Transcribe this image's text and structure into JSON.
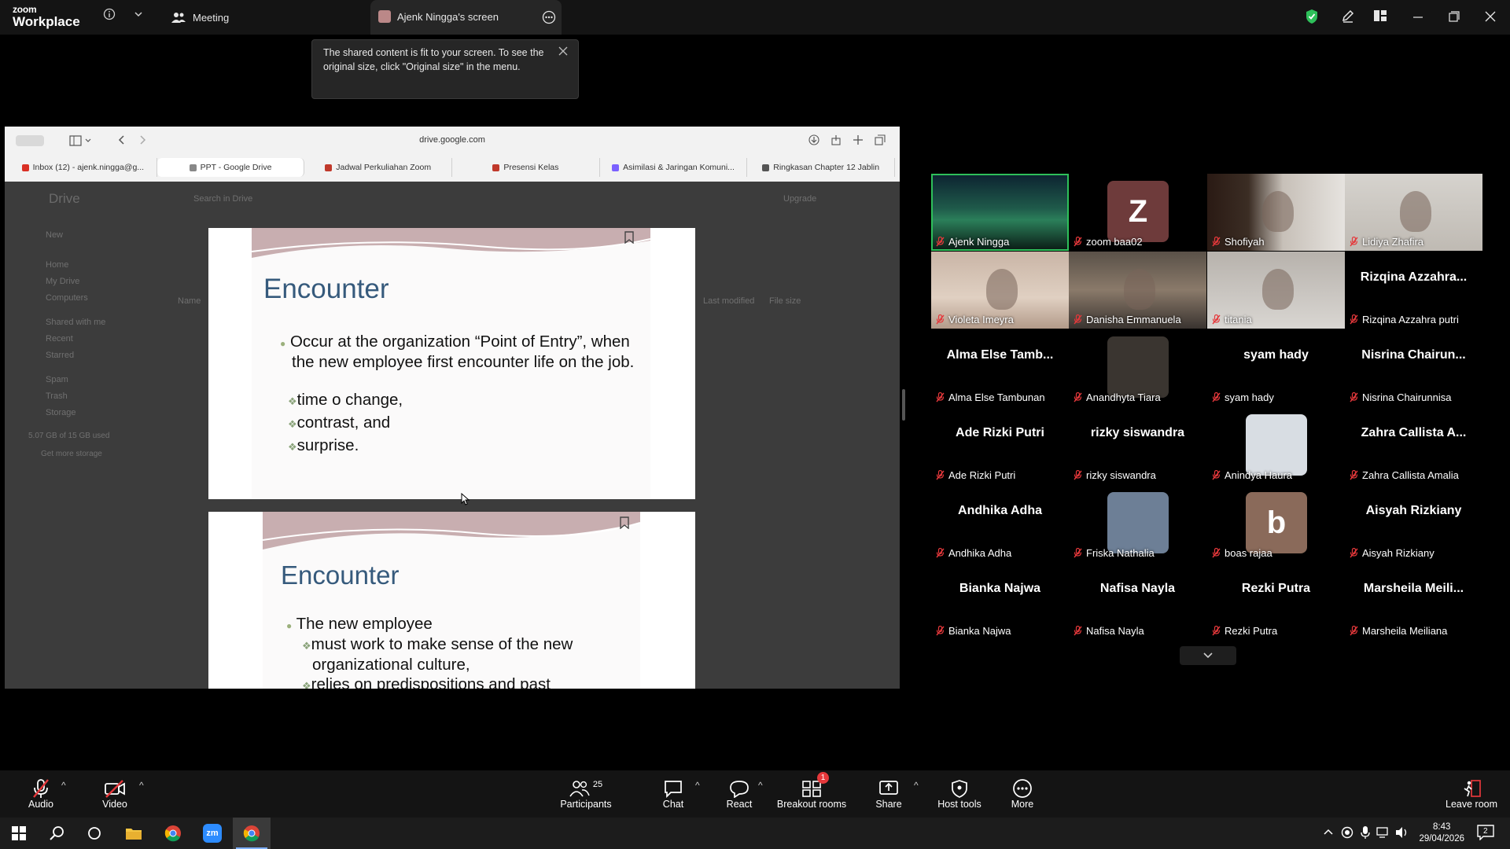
{
  "app": {
    "logo_line1": "zoom",
    "logo_line2": "Workplace"
  },
  "topbar": {
    "meeting_tab": "Meeting",
    "screen_tab": "Ajenk Ningga's screen",
    "icons": [
      "info-icon",
      "chevron-down-icon",
      "people-icon",
      "more-icon",
      "shield-check-icon",
      "pen-icon",
      "layout-icon",
      "minimize-icon",
      "maximize-icon",
      "close-icon"
    ],
    "security_color": "#2ec05a"
  },
  "tooltip": {
    "text": "The shared content is fit to your screen. To see the original size, click \"Original size\" in the menu."
  },
  "browser": {
    "url": "drive.google.com",
    "tabs": [
      {
        "label": "Inbox (12) - ajenk.ningga@g...",
        "color": "#d93025"
      },
      {
        "label": "PPT - Google Drive",
        "color": "#888888"
      },
      {
        "label": "Jadwal Perkuliahan Zoom",
        "color": "#c0392b"
      },
      {
        "label": "Presensi Kelas",
        "color": "#c0392b"
      },
      {
        "label": "Asimilasi & Jaringan Komuni...",
        "color": "#7b61ff"
      },
      {
        "label": "Ringkasan Chapter 12 Jablin",
        "color": "#555555"
      }
    ]
  },
  "drive": {
    "brand": "Drive",
    "search_placeholder": "Search in Drive",
    "upgrade": "Upgrade",
    "new_button": "New",
    "nav": [
      "Home",
      "My Drive",
      "Computers",
      "Shared with me",
      "Recent",
      "Starred",
      "Spam",
      "Trash",
      "Storage"
    ],
    "storage_text": "5.07 GB of 15 GB used",
    "get_storage": "Get more storage",
    "col_name": "Name",
    "col_modified": "Last modified",
    "col_size": "File size"
  },
  "slides": [
    {
      "title": "Encounter",
      "bullet": "Occur at the organization “Point of Entry”, when the new employee first encounter life on the job.",
      "subs": [
        "time o change,",
        "contrast, and",
        "surprise."
      ]
    },
    {
      "title": "Encounter",
      "bullet": "The new employee",
      "subs": [
        "must work to make sense of the new organizational culture,",
        "relies on predispositions and past"
      ]
    }
  ],
  "participants": [
    {
      "name": "Ajenk Ningga",
      "big": "",
      "type": "video",
      "active": true
    },
    {
      "name": "zoom baa02",
      "big": "Z",
      "type": "avatar",
      "avatar_color": "#6e3b3b"
    },
    {
      "name": "Shofiyah",
      "big": "",
      "type": "video"
    },
    {
      "name": "Lidiya Zhafira",
      "big": "",
      "type": "video"
    },
    {
      "name": "Violeta Imeyra",
      "big": "",
      "type": "video"
    },
    {
      "name": "Danisha Emmanuela",
      "big": "",
      "type": "video"
    },
    {
      "name": "titania",
      "big": "",
      "type": "video"
    },
    {
      "name": "Rizqina Azzahra putri",
      "big": "Rizqina  Azzahra...",
      "type": "text"
    },
    {
      "name": "Alma Else Tambunan",
      "big": "Alma Else Tamb...",
      "type": "text"
    },
    {
      "name": "Anandhyta Tiara",
      "big": "",
      "type": "photo"
    },
    {
      "name": "syam hady",
      "big": "syam hady",
      "type": "text"
    },
    {
      "name": "Nisrina Chairunnisa",
      "big": "Nisrina  Chairun...",
      "type": "text"
    },
    {
      "name": "Ade Rizki Putri",
      "big": "Ade Rizki Putri",
      "type": "text"
    },
    {
      "name": "rizky siswandra",
      "big": "rizky siswandra",
      "type": "text"
    },
    {
      "name": "Anindya Haura",
      "big": "",
      "type": "photo"
    },
    {
      "name": "Zahra Callista Amalia",
      "big": "Zahra Callista A...",
      "type": "text"
    },
    {
      "name": "Andhika Adha",
      "big": "Andhika Adha",
      "type": "text"
    },
    {
      "name": "Friska Nathalia",
      "big": "",
      "type": "photo"
    },
    {
      "name": "boas rajaa",
      "big": "b",
      "type": "avatar",
      "avatar_color": "#8a6a5a"
    },
    {
      "name": "Aisyah Rizkiany",
      "big": "Aisyah Rizkiany",
      "type": "text"
    },
    {
      "name": "Bianka Najwa",
      "big": "Bianka Najwa",
      "type": "text"
    },
    {
      "name": "Nafisa Nayla",
      "big": "Nafisa Nayla",
      "type": "text"
    },
    {
      "name": "Rezki Putra",
      "big": "Rezki Putra",
      "type": "text"
    },
    {
      "name": "Marsheila Meiliana",
      "big": "Marsheila  Meili...",
      "type": "text"
    }
  ],
  "toolbar": {
    "audio": "Audio",
    "video": "Video",
    "participants": "Participants",
    "participants_count": "25",
    "chat": "Chat",
    "react": "React",
    "breakout": "Breakout rooms",
    "breakout_badge": "1",
    "share": "Share",
    "host_tools": "Host tools",
    "more": "More",
    "leave": "Leave room"
  },
  "taskbar": {
    "time": "8:43",
    "date": "29/04/2026",
    "notification_count": "2"
  }
}
